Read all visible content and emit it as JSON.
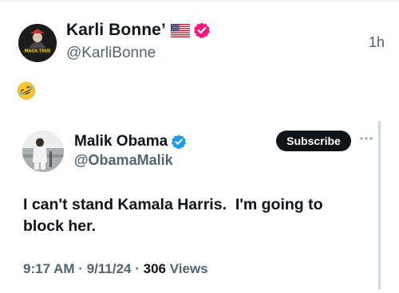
{
  "outer_post": {
    "display_name": "Karli Bonne’",
    "handle": "@KarliBonne",
    "time": "1h",
    "body_emoji": "rolling-on-floor-laughing",
    "avatar_text": "MAGA TRUE"
  },
  "quoted_post": {
    "display_name": "Malik Obama",
    "handle": "@ObamaMalik",
    "subscribe_label": "Subscribe",
    "text": "I can't stand Kamala Harris.  I'm going to block her.",
    "time": "9:17 AM",
    "sep1": "·",
    "date": "9/11/24",
    "sep2": "·",
    "views_count": "306",
    "views_label": "Views"
  },
  "colors": {
    "text_primary": "#0f1419",
    "text_secondary": "#536471",
    "verified_outer": "#f91880",
    "verified_inner": "#1d9bf0",
    "border": "#cfd9de"
  },
  "icons": {
    "flag": "us-flag-icon",
    "verified_outer": "verified-badge-icon",
    "verified_inner": "verified-badge-icon",
    "more": "more-dots-icon",
    "emoji": "rofl-emoji-icon"
  }
}
